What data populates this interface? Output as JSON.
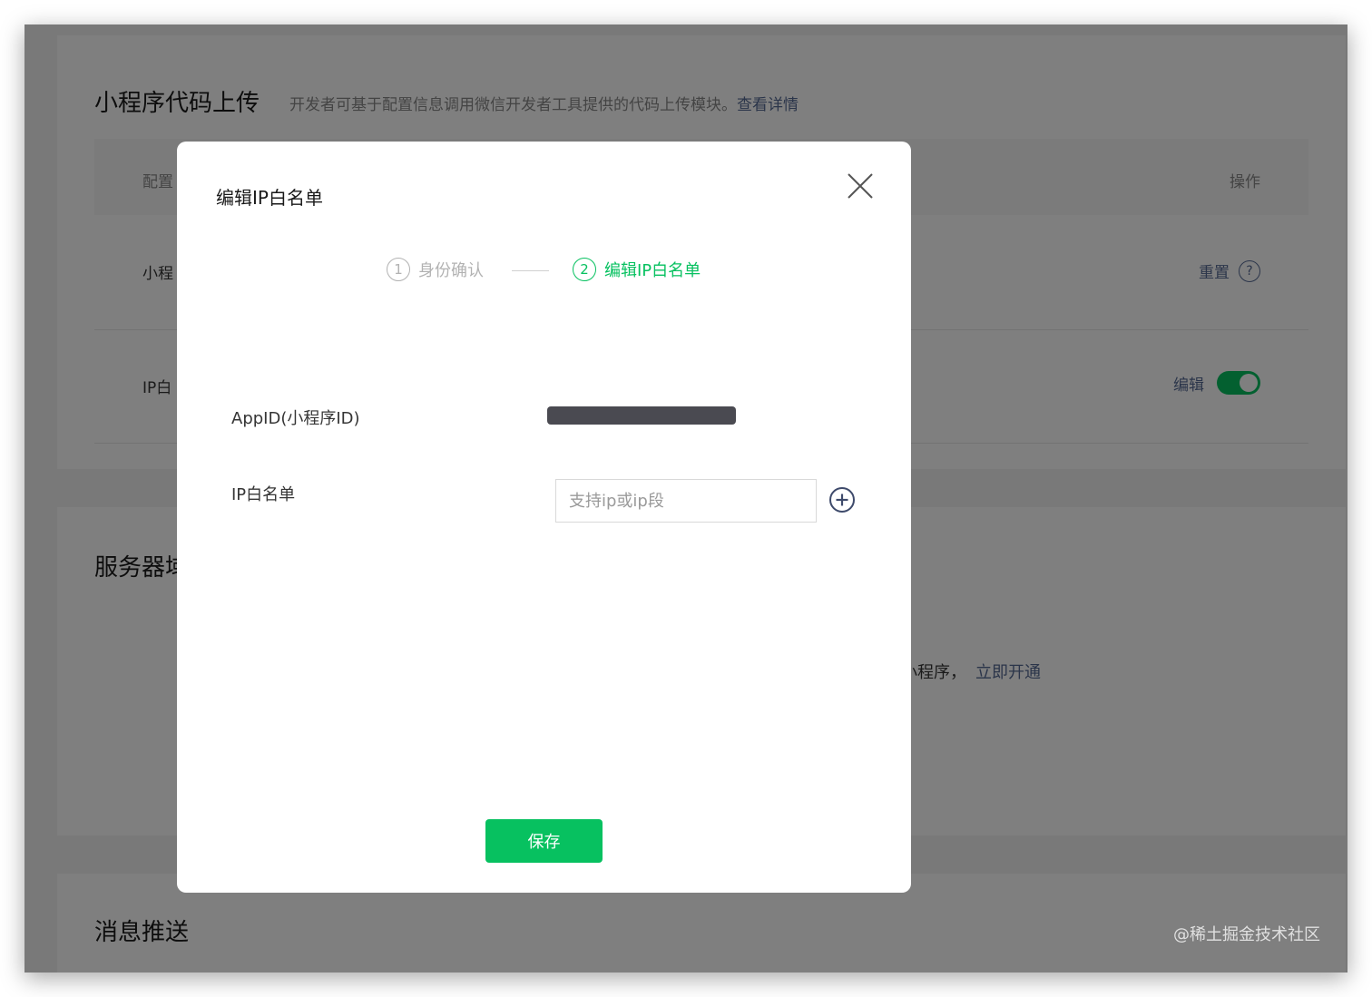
{
  "background": {
    "section_code_upload": {
      "title": "小程序代码上传",
      "desc": "开发者可基于配置信息调用微信开发者工具提供的代码上传模块。",
      "desc_link": "查看详情",
      "table_header": {
        "col_config": "配置",
        "col_action": "操作"
      },
      "rows": [
        {
          "label": "小程",
          "action": "重置",
          "help": "?"
        },
        {
          "label": "IP白",
          "action": "编辑",
          "toggle_on": true
        }
      ]
    },
    "section_server": {
      "title": "服务器域",
      "text": "小程序，",
      "link": "立即开通"
    },
    "section_message": {
      "title": "消息推送"
    }
  },
  "modal": {
    "title": "编辑IP白名单",
    "steps": [
      {
        "num": "1",
        "label": "身份确认",
        "state": "done"
      },
      {
        "num": "2",
        "label": "编辑IP白名单",
        "state": "active"
      }
    ],
    "appid_label": "AppID(小程序ID)",
    "ip_label": "IP白名单",
    "ip_placeholder": "支持ip或ip段",
    "save_label": "保存"
  },
  "watermark": "@稀土掘金技术社区",
  "colors": {
    "accent": "#07c160",
    "link": "#576b95"
  }
}
